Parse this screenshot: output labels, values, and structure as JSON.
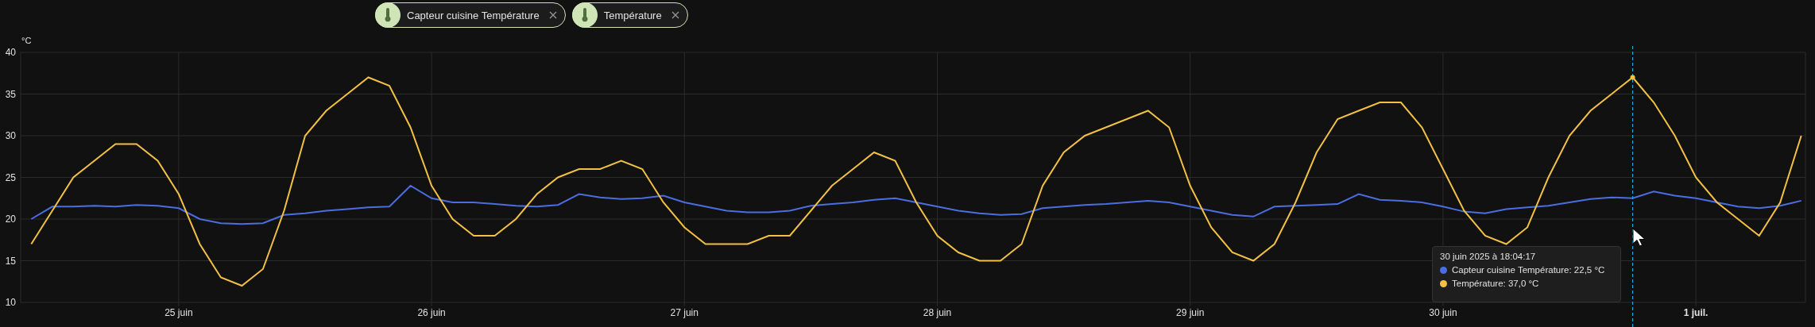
{
  "chart": {
    "unit": "°C",
    "chart_data": {
      "type": "line",
      "grid": true,
      "ylim": [
        10,
        40
      ],
      "yticks": [
        10,
        15,
        20,
        25,
        30,
        35,
        40
      ],
      "categories": [
        null,
        null,
        null,
        null,
        null,
        null,
        null,
        "25 juin",
        null,
        null,
        null,
        null,
        null,
        null,
        null,
        null,
        null,
        null,
        null,
        "26 juin",
        null,
        null,
        null,
        null,
        null,
        null,
        null,
        null,
        null,
        null,
        null,
        "27 juin",
        null,
        null,
        null,
        null,
        null,
        null,
        null,
        null,
        null,
        null,
        null,
        "28 juin",
        null,
        null,
        null,
        null,
        null,
        null,
        null,
        null,
        null,
        null,
        null,
        "29 juin",
        null,
        null,
        null,
        null,
        null,
        null,
        null,
        null,
        null,
        null,
        null,
        "30 juin",
        null,
        null,
        null,
        null,
        null,
        null,
        null,
        null,
        null,
        null,
        null,
        "1 juil.",
        null,
        null,
        null,
        null,
        null
      ],
      "series": [
        {
          "name": "Capteur cuisine Température",
          "color": "#4a6ee0",
          "values": [
            20,
            21.5,
            21.5,
            21.6,
            21.5,
            21.7,
            21.6,
            21.3,
            20,
            19.5,
            19.4,
            19.5,
            20.5,
            20.7,
            21,
            21.2,
            21.4,
            21.5,
            24,
            22.5,
            22,
            22,
            21.8,
            21.6,
            21.5,
            21.7,
            23,
            22.6,
            22.4,
            22.5,
            22.8,
            22,
            21.5,
            21,
            20.8,
            20.8,
            21,
            21.6,
            21.8,
            22,
            22.3,
            22.5,
            22,
            21.5,
            21,
            20.7,
            20.5,
            20.6,
            21.3,
            21.5,
            21.7,
            21.8,
            22,
            22.2,
            22,
            21.5,
            21,
            20.5,
            20.3,
            21.5,
            21.6,
            21.7,
            21.8,
            23,
            22.3,
            22.2,
            22,
            21.5,
            20.9,
            20.7,
            21.2,
            21.4,
            21.6,
            22,
            22.4,
            22.6,
            22.5,
            23.3,
            22.8,
            22.5,
            22,
            21.5,
            21.3,
            21.6,
            22.2
          ]
        },
        {
          "name": "Température",
          "color": "#f2c043",
          "values": [
            17,
            21,
            25,
            27,
            29,
            29,
            27,
            23,
            17,
            13,
            12,
            14,
            21,
            30,
            33,
            35,
            37,
            36,
            31,
            24,
            20,
            18,
            18,
            20,
            23,
            25,
            26,
            26,
            27,
            26,
            22,
            19,
            17,
            17,
            17,
            18,
            18,
            21,
            24,
            26,
            28,
            27,
            22,
            18,
            16,
            15,
            15,
            17,
            24,
            28,
            30,
            31,
            32,
            33,
            31,
            24,
            19,
            16,
            15,
            17,
            22,
            28,
            32,
            33,
            34,
            34,
            31,
            26,
            21,
            18,
            17,
            19,
            25,
            30,
            33,
            35,
            37,
            34,
            30,
            25,
            22,
            20,
            18,
            22,
            30
          ]
        }
      ]
    },
    "tooltip": {
      "title": "30 juin 2025 à 18:04:17",
      "rows": [
        {
          "text": "Capteur cuisine Température: 22,5 °C",
          "color": "#4a6ee0"
        },
        {
          "text": "Température: 37,0 °C",
          "color": "#f2c043"
        }
      ]
    }
  }
}
